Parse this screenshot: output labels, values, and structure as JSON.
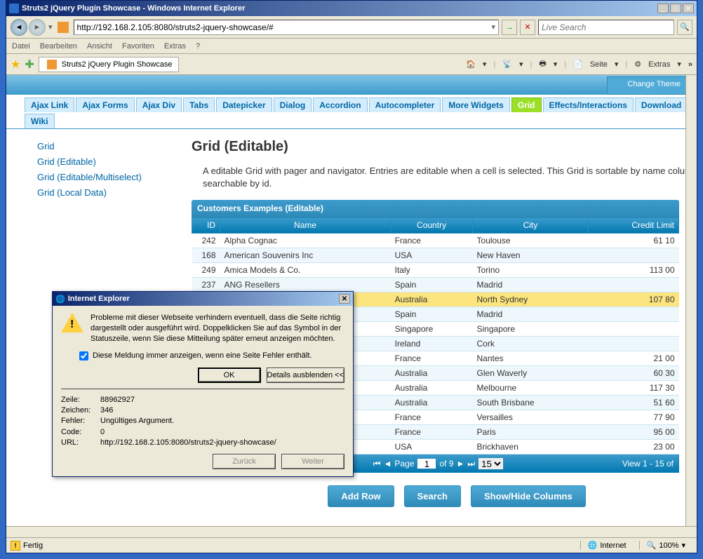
{
  "window": {
    "title": "Struts2 jQuery Plugin Showcase - Windows Internet Explorer"
  },
  "nav": {
    "url": "http://192.168.2.105:8080/struts2-jquery-showcase/#",
    "search_placeholder": "Live Search"
  },
  "menu": {
    "items": [
      "Datei",
      "Bearbeiten",
      "Ansicht",
      "Favoriten",
      "Extras",
      "?"
    ]
  },
  "favbar": {
    "tab": "Struts2 jQuery Plugin Showcase",
    "page_label": "Seite",
    "extras_label": "Extras"
  },
  "header": {
    "change_theme": "Change Theme"
  },
  "tabs": [
    "Ajax Link",
    "Ajax Forms",
    "Ajax Div",
    "Tabs",
    "Datepicker",
    "Dialog",
    "Accordion",
    "Autocompleter",
    "More Widgets",
    "Grid",
    "Effects/Interactions",
    "Download",
    "Wiki"
  ],
  "tabs_active": "Grid",
  "sidebar": {
    "items": [
      "Grid",
      "Grid (Editable)",
      "Grid (Editable/Multiselect)",
      "Grid (Local Data)"
    ]
  },
  "page": {
    "title": "Grid (Editable)",
    "desc": "A editable Grid with pager and navigator. Entries are editable when a cell is selected. This Grid is sortable by name column and searchable by id."
  },
  "grid": {
    "caption": "Customers Examples (Editable)",
    "columns": [
      "ID",
      "Name",
      "Country",
      "City",
      "Credit Limit"
    ],
    "rows": [
      {
        "id": "242",
        "name": "Alpha Cognac",
        "country": "France",
        "city": "Toulouse",
        "limit": "61 10"
      },
      {
        "id": "168",
        "name": "American Souvenirs Inc",
        "country": "USA",
        "city": "New Haven",
        "limit": ""
      },
      {
        "id": "249",
        "name": "Amica Models & Co.",
        "country": "Italy",
        "city": "Torino",
        "limit": "113 00"
      },
      {
        "id": "237",
        "name": "ANG Resellers",
        "country": "Spain",
        "city": "Madrid",
        "limit": ""
      },
      {
        "id": "",
        "name": "",
        "country": "Australia",
        "city": "North Sydney",
        "limit": "107 80",
        "sel": true
      },
      {
        "id": "",
        "name": "",
        "country": "Spain",
        "city": "Madrid",
        "limit": ""
      },
      {
        "id": "",
        "name": "",
        "country": "Singapore",
        "city": "Singapore",
        "limit": ""
      },
      {
        "id": "",
        "name": "",
        "country": "Ireland",
        "city": "Cork",
        "limit": ""
      },
      {
        "id": "",
        "name": "",
        "country": "France",
        "city": "Nantes",
        "limit": "21 00"
      },
      {
        "id": "",
        "name": "",
        "country": "Australia",
        "city": "Glen Waverly",
        "limit": "60 30"
      },
      {
        "id": "",
        "name": "",
        "country": "Australia",
        "city": "Melbourne",
        "limit": "117 30"
      },
      {
        "id": "",
        "name": "",
        "country": "Australia",
        "city": "South Brisbane",
        "limit": "51 60"
      },
      {
        "id": "",
        "name": "",
        "country": "France",
        "city": "Versailles",
        "limit": "77 90"
      },
      {
        "id": "",
        "name": "",
        "country": "France",
        "city": "Paris",
        "limit": "95 00"
      },
      {
        "id": "",
        "name": "",
        "country": "USA",
        "city": "Brickhaven",
        "limit": "23 00"
      }
    ]
  },
  "pager": {
    "page_label": "Page",
    "page_val": "1",
    "of_label": "of 9",
    "rows_val": "15",
    "view_label": "View 1 - 15 of"
  },
  "actions": {
    "add": "Add Row",
    "search": "Search",
    "cols": "Show/Hide Columns"
  },
  "status": {
    "text": "Fertig",
    "zone": "Internet",
    "zoom": "100%"
  },
  "dialog": {
    "title": "Internet Explorer",
    "msg": "Probleme mit dieser Webseite verhindern eventuell, dass die Seite richtig dargestellt oder ausgeführt wird. Doppelklicken Sie auf das Symbol in der Statuszeile, wenn Sie diese Mitteilung später erneut anzeigen möchten.",
    "checkbox": "Diese Meldung immer anzeigen, wenn eine Seite Fehler enthält.",
    "ok": "OK",
    "details_btn": "Details ausblenden <<",
    "back": "Zurück",
    "fwd": "Weiter",
    "details": {
      "zeile_lbl": "Zeile:",
      "zeile": "88962927",
      "zeichen_lbl": "Zeichen:",
      "zeichen": "346",
      "fehler_lbl": "Fehler:",
      "fehler": "Ungültiges Argument.",
      "code_lbl": "Code:",
      "code": "0",
      "url_lbl": "URL:",
      "url": "http://192.168.2.105:8080/struts2-jquery-showcase/"
    }
  }
}
